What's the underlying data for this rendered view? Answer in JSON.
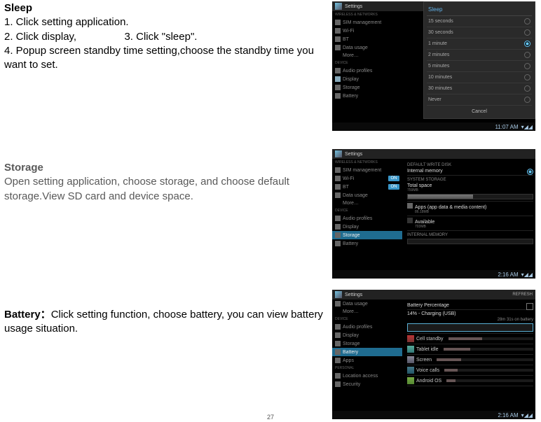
{
  "page_number": "27",
  "sleep": {
    "heading": "Sleep",
    "line1": "1. Click setting application.",
    "line2a": "2. Click display,",
    "line2b": "3. Click \"sleep\".",
    "line3": "4. Popup screen standby time setting,choose the standby time you want to set."
  },
  "storage": {
    "heading": "Storage",
    "body": "Open setting application, choose storage, and choose default storage.View SD card and device space."
  },
  "battery": {
    "heading": "Battery：",
    "body": "Click setting function, choose battery, you can view battery usage situation."
  },
  "screens": {
    "common": {
      "settings_label": "Settings",
      "nav_items": {
        "wireless_header": "WIRELESS & NETWORKS",
        "sim": "SIM management",
        "wifi": "Wi-Fi",
        "bt": "BT",
        "data": "Data usage",
        "more": "More…",
        "device_header": "DEVICE",
        "audio": "Audio profiles",
        "display": "Display",
        "storage": "Storage",
        "battery": "Battery",
        "apps": "Apps",
        "personal_header": "PERSONAL",
        "location": "Location access",
        "security": "Security"
      },
      "toggle_on": "ON"
    },
    "sleep": {
      "dialog_title": "Sleep",
      "options": [
        "15 seconds",
        "30 seconds",
        "1 minute",
        "2 minutes",
        "5 minutes",
        "10 minutes",
        "30 minutes",
        "Never"
      ],
      "selected_index": 2,
      "cancel": "Cancel",
      "clock": "11:07 AM"
    },
    "storage": {
      "write_header": "DEFAULT WRITE DISK",
      "internal_memory": "Internal memory",
      "system_header": "SYSTEM STORAGE",
      "total_space": "Total space",
      "total_sub": "759MB",
      "apps_label": "Apps (app data & media content)",
      "apps_sub": "86.18MB",
      "available": "Available",
      "available_sub": "703MB",
      "internal_header": "INTERNAL MEMORY",
      "clock": "2:16 AM"
    },
    "battery": {
      "refresh": "REFRESH",
      "percentage_label": "Battery Percentage",
      "status_line": "14% - Charging (USB)",
      "duration": "28m 31s on battery",
      "items": [
        {
          "name": "Cell standby",
          "bar": "w40"
        },
        {
          "name": "Tablet idle",
          "bar": "w30"
        },
        {
          "name": "Screen",
          "bar": "w25"
        },
        {
          "name": "Voice calls",
          "bar": "w15"
        },
        {
          "name": "Android OS",
          "bar": "w10"
        }
      ],
      "clock": "2:16 AM"
    }
  }
}
